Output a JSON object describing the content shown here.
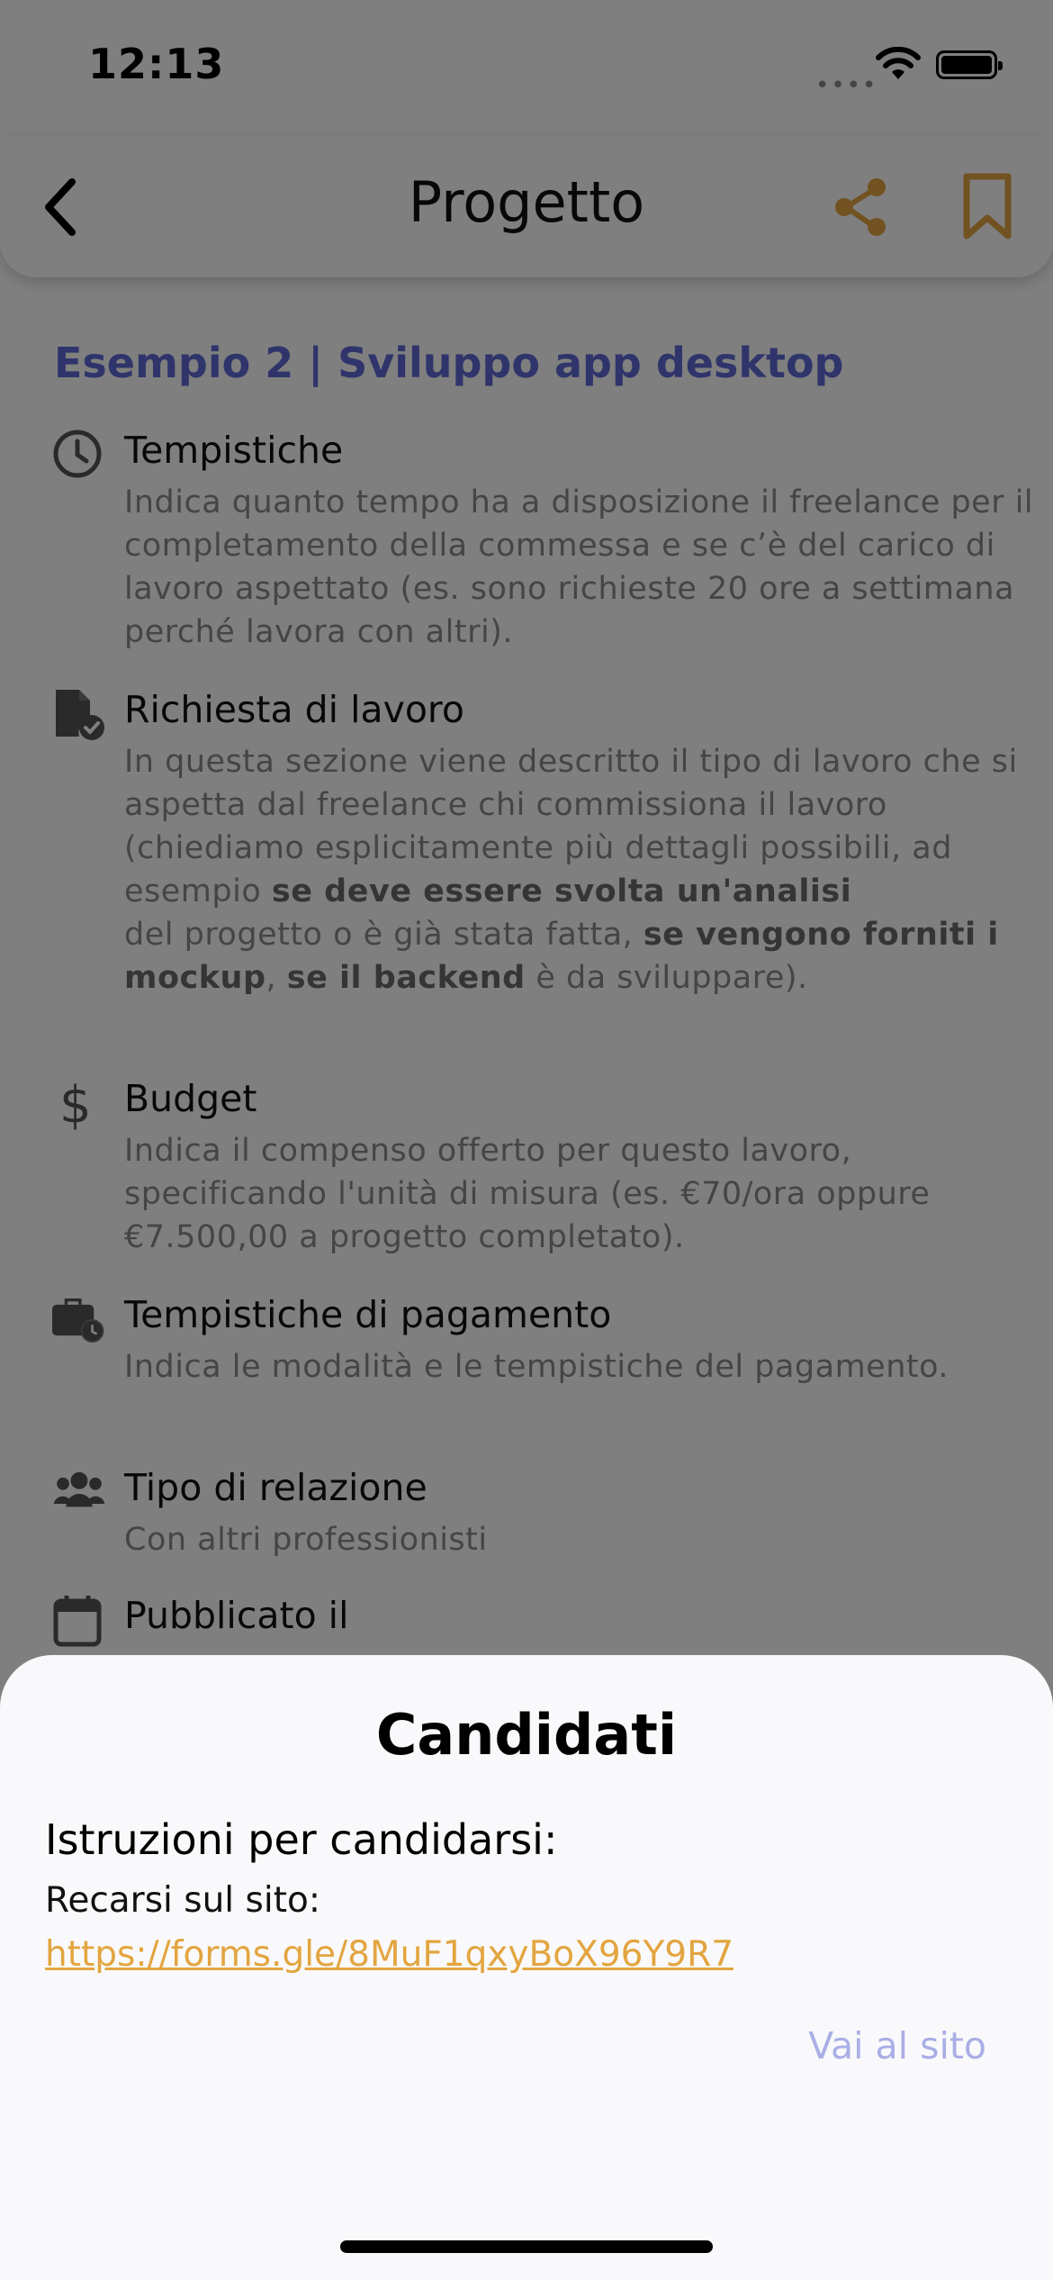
{
  "status_bar": {
    "time": "12:13",
    "signal_dots": "••••"
  },
  "nav": {
    "title": "Progetto"
  },
  "project": {
    "title": "Esempio 2 | Sviluppo app desktop",
    "sections": [
      {
        "icon": "clock-icon",
        "heading": "Tempistiche",
        "body": "Indica quanto tempo ha a disposizione il freelance per il completamento della commessa e se c’è del carico di lavoro aspettato (es. sono richieste 20 ore a settimana perché lavora con altri)."
      },
      {
        "icon": "document-check-icon",
        "heading": "Richiesta di lavoro",
        "body_parts": {
          "p1": "In questa sezione viene descritto il tipo di lavoro che si aspetta dal freelance chi commissiona il lavoro (chiediamo esplicitamente più dettagli possibili, ad esempio ",
          "b1": "se deve essere svolta un'analisi",
          "p2": " del progetto o è già stata fatta, ",
          "b2": "se vengono forniti i mockup",
          "p3": ", ",
          "b3": "se il backend",
          "p4": " è da sviluppare)."
        }
      },
      {
        "icon": "dollar-icon",
        "heading": "Budget",
        "body": "Indica il compenso offerto per questo lavoro, specificando l'unità di misura (es. €70/ora oppure €7.500,00 a progetto completato)."
      },
      {
        "icon": "briefcase-clock-icon",
        "heading": "Tempistiche di pagamento",
        "body": "Indica le modalità e le tempistiche del pagamento."
      },
      {
        "icon": "people-icon",
        "heading": "Tipo di relazione",
        "body": "Con altri professionisti"
      },
      {
        "icon": "calendar-icon",
        "heading": "Pubblicato il"
      }
    ]
  },
  "sheet": {
    "title": "Candidati",
    "instructions": "Istruzioni per candidarsi:",
    "subtitle": "Recarsi sul sito:",
    "link": "https://forms.gle/8MuF1qxyBoX96Y9R7",
    "button_label": "Vai al sito"
  },
  "colors": {
    "accent_orange": "#e3a540",
    "title_blue": "#5f6bd6",
    "button_lavender": "#a9aee6"
  }
}
